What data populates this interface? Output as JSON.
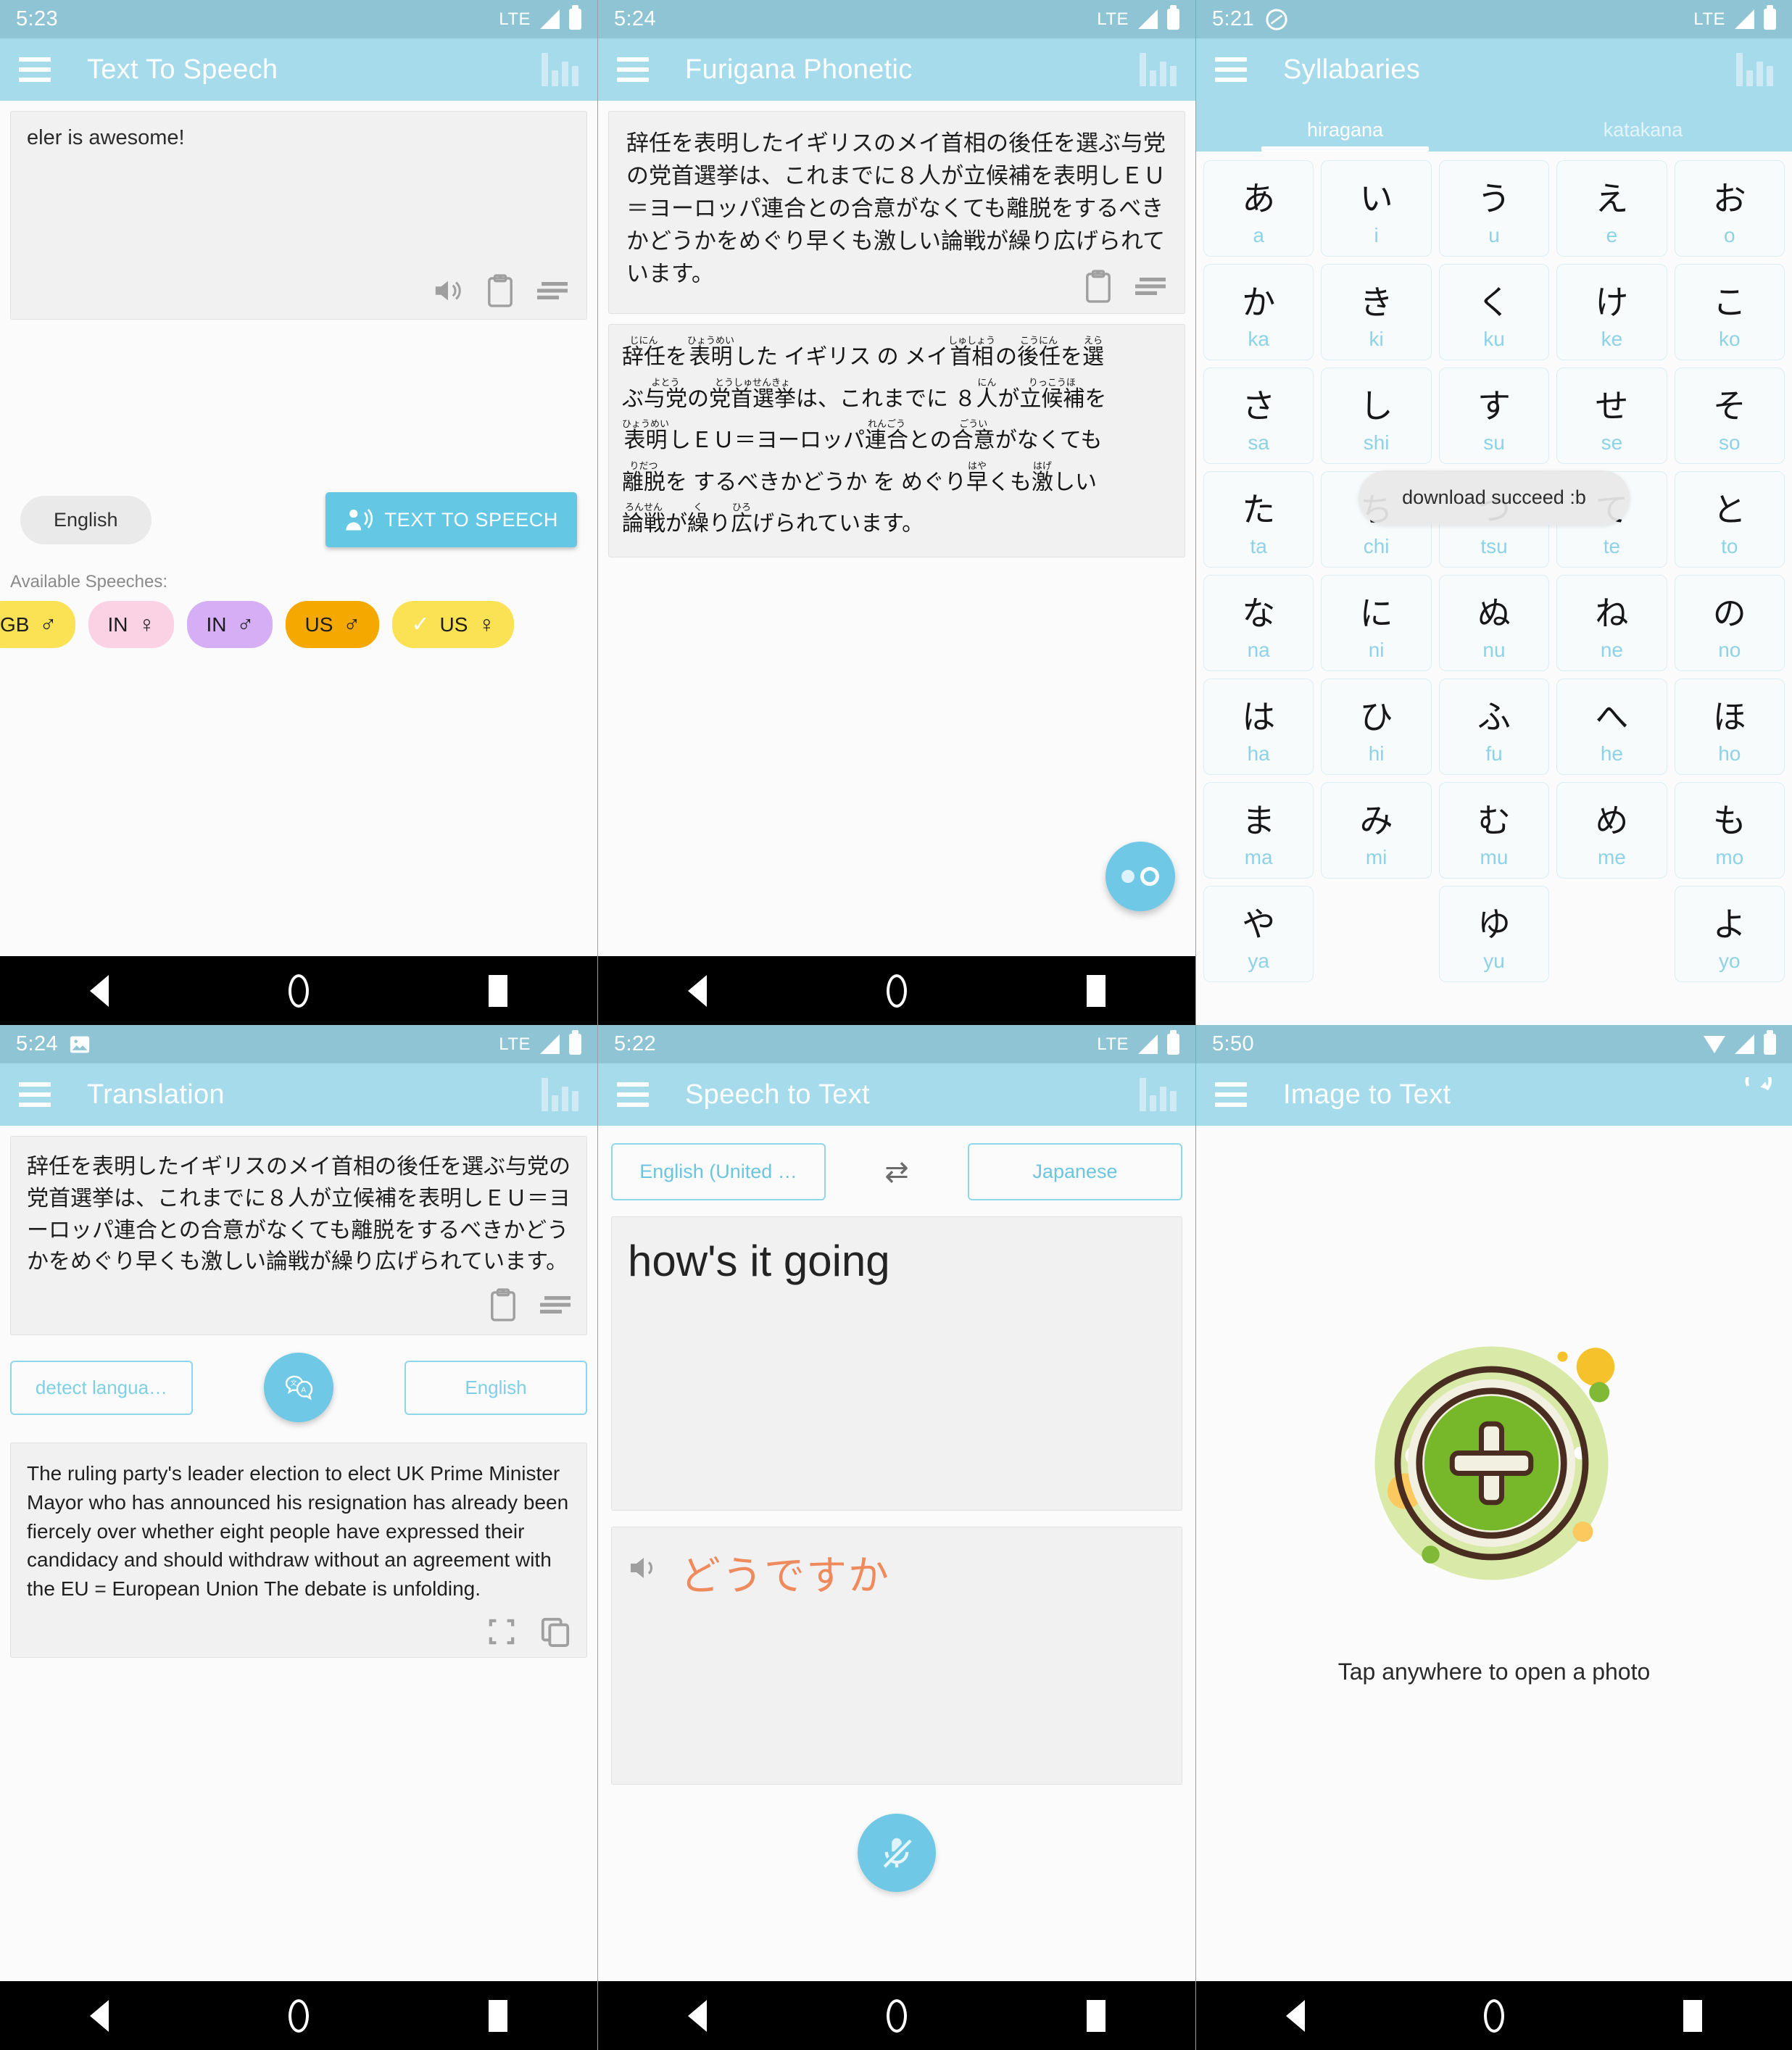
{
  "panels": {
    "text_to_speech": {
      "status_time": "5:23",
      "status_network": "LTE",
      "title": "Text To Speech",
      "input_value": "eler is awesome!",
      "language_chip": "English",
      "speak_button": "TEXT TO SPEECH",
      "available_label": "Available Speeches:",
      "voices": [
        {
          "region": "GB",
          "gender": "♂",
          "color": "#fbe255",
          "selected": false
        },
        {
          "region": "IN",
          "gender": "♀",
          "color": "#fbd2e4",
          "selected": false
        },
        {
          "region": "IN",
          "gender": "♂",
          "color": "#d6aef6",
          "selected": false
        },
        {
          "region": "US",
          "gender": "♂",
          "color": "#f5a800",
          "selected": false
        },
        {
          "region": "US",
          "gender": "♀",
          "color": "#fbe255",
          "selected": true
        }
      ],
      "icons": [
        "speaker-icon",
        "clipboard-icon",
        "list-icon",
        "bar-chart-icon",
        "hamburger-menu-icon"
      ]
    },
    "furigana": {
      "status_time": "5:24",
      "status_network": "LTE",
      "title": "Furigana Phonetic",
      "source_text": "辞任を表明したイギリスのメイ首相の後任を選ぶ与党の党首選挙は、これまでに８人が立候補を表明しＥＵ＝ヨーロッパ連合との合意がなくても離脱をするべきかどうかをめぐり早くも激しい論戦が繰り広げられています。",
      "ruby_lines": [
        [
          {
            "base": "辞任",
            "rt": "じにん"
          },
          {
            "base": "を",
            "rt": ""
          },
          {
            "base": "表明",
            "rt": "ひょうめい"
          },
          {
            "base": "した イギリス の メイ ",
            "rt": ""
          },
          {
            "base": "首相",
            "rt": "しゅしょう"
          },
          {
            "base": "の",
            "rt": ""
          },
          {
            "base": "後任",
            "rt": "こうにん"
          },
          {
            "base": "を",
            "rt": ""
          },
          {
            "base": "選",
            "rt": "えら"
          }
        ],
        [
          {
            "base": "ぶ",
            "rt": ""
          },
          {
            "base": "与党",
            "rt": "よとう"
          },
          {
            "base": "の",
            "rt": ""
          },
          {
            "base": "党首選挙",
            "rt": "とうしゅせんきょ"
          },
          {
            "base": "は、これまでに ８",
            "rt": ""
          },
          {
            "base": "人",
            "rt": "にん"
          },
          {
            "base": "が",
            "rt": ""
          },
          {
            "base": "立候補",
            "rt": "りっこうほ"
          },
          {
            "base": "を",
            "rt": ""
          }
        ],
        [
          {
            "base": "表明",
            "rt": "ひょうめい"
          },
          {
            "base": "しＥＵ＝ヨーロッパ",
            "rt": ""
          },
          {
            "base": "連合",
            "rt": "れんごう"
          },
          {
            "base": "との",
            "rt": ""
          },
          {
            "base": "合意",
            "rt": "ごうい"
          },
          {
            "base": "がなくても",
            "rt": ""
          }
        ],
        [
          {
            "base": "離脱",
            "rt": "りだつ"
          },
          {
            "base": "を するべきかどうか を めぐり",
            "rt": ""
          },
          {
            "base": "早",
            "rt": "はや"
          },
          {
            "base": "くも",
            "rt": ""
          },
          {
            "base": "激",
            "rt": "はげ"
          },
          {
            "base": "しい",
            "rt": ""
          }
        ],
        [
          {
            "base": "論戦",
            "rt": "ろんせん"
          },
          {
            "base": "が",
            "rt": ""
          },
          {
            "base": "繰",
            "rt": "く"
          },
          {
            "base": "り",
            "rt": ""
          },
          {
            "base": "広",
            "rt": "ひろ"
          },
          {
            "base": "げられています。",
            "rt": ""
          }
        ]
      ],
      "icons": [
        "clipboard-icon",
        "list-icon",
        "bar-chart-icon",
        "hamburger-menu-icon",
        "convert-fab-icon"
      ]
    },
    "syllabaries": {
      "status_time": "5:21",
      "status_network": "LTE",
      "title": "Syllabaries",
      "tabs": [
        {
          "label": "hiragana",
          "active": true
        },
        {
          "label": "katakana",
          "active": false
        }
      ],
      "kana": [
        {
          "char": "あ",
          "romaji": "a"
        },
        {
          "char": "い",
          "romaji": "i"
        },
        {
          "char": "う",
          "romaji": "u"
        },
        {
          "char": "え",
          "romaji": "e"
        },
        {
          "char": "お",
          "romaji": "o"
        },
        {
          "char": "か",
          "romaji": "ka"
        },
        {
          "char": "き",
          "romaji": "ki"
        },
        {
          "char": "く",
          "romaji": "ku"
        },
        {
          "char": "け",
          "romaji": "ke"
        },
        {
          "char": "こ",
          "romaji": "ko"
        },
        {
          "char": "さ",
          "romaji": "sa"
        },
        {
          "char": "し",
          "romaji": "shi"
        },
        {
          "char": "す",
          "romaji": "su"
        },
        {
          "char": "せ",
          "romaji": "se"
        },
        {
          "char": "そ",
          "romaji": "so"
        },
        {
          "char": "た",
          "romaji": "ta"
        },
        {
          "char": "ち",
          "romaji": "chi"
        },
        {
          "char": "つ",
          "romaji": "tsu"
        },
        {
          "char": "て",
          "romaji": "te"
        },
        {
          "char": "と",
          "romaji": "to"
        },
        {
          "char": "な",
          "romaji": "na"
        },
        {
          "char": "に",
          "romaji": "ni"
        },
        {
          "char": "ぬ",
          "romaji": "nu"
        },
        {
          "char": "ね",
          "romaji": "ne"
        },
        {
          "char": "の",
          "romaji": "no"
        },
        {
          "char": "は",
          "romaji": "ha"
        },
        {
          "char": "ひ",
          "romaji": "hi"
        },
        {
          "char": "ふ",
          "romaji": "fu"
        },
        {
          "char": "へ",
          "romaji": "he"
        },
        {
          "char": "ほ",
          "romaji": "ho"
        },
        {
          "char": "ま",
          "romaji": "ma"
        },
        {
          "char": "み",
          "romaji": "mi"
        },
        {
          "char": "む",
          "romaji": "mu"
        },
        {
          "char": "め",
          "romaji": "me"
        },
        {
          "char": "も",
          "romaji": "mo"
        },
        {
          "char": "や",
          "romaji": "ya"
        },
        {
          "char": "",
          "romaji": ""
        },
        {
          "char": "ゆ",
          "romaji": "yu"
        },
        {
          "char": "",
          "romaji": ""
        },
        {
          "char": "よ",
          "romaji": "yo"
        }
      ],
      "toast": "download succeed :b"
    },
    "translation": {
      "status_time": "5:24",
      "status_network": "LTE",
      "title": "Translation",
      "source_text": "辞任を表明したイギリスのメイ首相の後任を選ぶ与党の党首選挙は、これまでに８人が立候補を表明しＥＵ＝ヨーロッパ連合との合意がなくても離脱をするべきかどうかをめぐり早くも激しい論戦が繰り広げられています。",
      "source_lang": "detect langua…",
      "target_lang": "English",
      "result_text": "The ruling party's leader election to elect UK Prime Minister Mayor who has announced his resignation has already been fiercely over whether eight people have expressed their candidacy and should withdraw without an agreement with the EU = European Union The debate is unfolding.",
      "icons": [
        "clipboard-icon",
        "list-icon",
        "translate-fab-icon",
        "fullscreen-icon",
        "copy-icon",
        "bar-chart-icon",
        "hamburger-menu-icon"
      ]
    },
    "speech_to_text": {
      "status_time": "5:22",
      "status_network": "LTE",
      "title": "Speech to Text",
      "source_lang": "English (United …",
      "target_lang": "Japanese",
      "swap_icon": "⇄",
      "recognized_text": "how's it going",
      "translated_text": "どうですか",
      "icons": [
        "swap-icon",
        "speaker-icon",
        "mic-off-icon",
        "bar-chart-icon",
        "hamburger-menu-icon"
      ]
    },
    "image_to_text": {
      "status_time": "5:50",
      "title": "Image to Text",
      "empty_label": "Tap anywhere to open a photo",
      "icons": [
        "refresh-icon",
        "plus-icon",
        "hamburger-menu-icon",
        "wifi-icon"
      ]
    }
  },
  "navbar": {
    "back": "back-button",
    "home": "home-button",
    "recents": "recents-button"
  },
  "colors": {
    "appbar": "#a6dbec",
    "statusbar": "#8fc4d4",
    "accent": "#6fc9e6",
    "romaji": "#8ed2e8",
    "translated": "#ef8a5c"
  }
}
